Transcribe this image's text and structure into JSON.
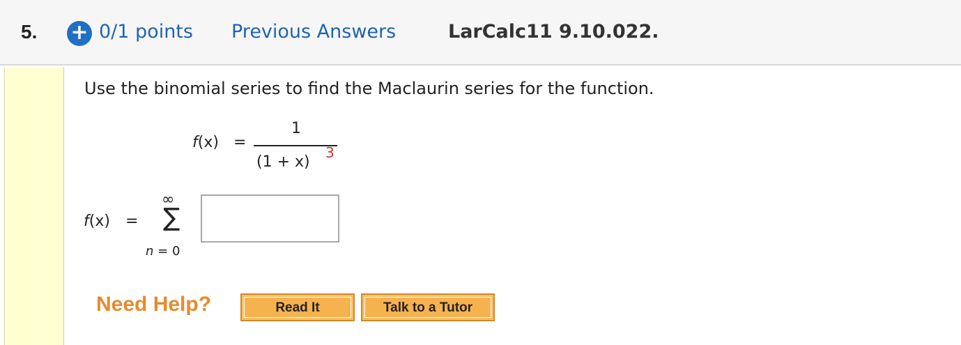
{
  "header": {
    "question_number": "5.",
    "expand_icon": "plus-circle-icon",
    "expand_symbol": "+",
    "points": "0/1 points",
    "previous_answers": "Previous Answers",
    "question_id": "LarCalc11 9.10.022."
  },
  "question": {
    "prompt": "Use the binomial series to find the Maclaurin series for the function.",
    "function": {
      "lhs_name": "f",
      "lhs_arg": "(x)",
      "equals": "=",
      "numerator": "1",
      "denominator": "(1 + x)",
      "exponent": "3",
      "exponent_color": "#e0312b"
    },
    "series": {
      "lhs_name": "f",
      "lhs_arg": "(x)",
      "equals": "=",
      "upper_limit": "∞",
      "sigma": "∑",
      "lower_limit_var": "n",
      "lower_limit_rest": " = 0",
      "answer_value": ""
    }
  },
  "help": {
    "label": "Need Help?",
    "read_it": "Read It",
    "talk_to_tutor": "Talk to a Tutor"
  },
  "colors": {
    "link_blue": "#1f63b3",
    "help_orange": "#e78a2d",
    "button_orange": "#f7b250",
    "strip_yellow": "#ffffd2"
  }
}
